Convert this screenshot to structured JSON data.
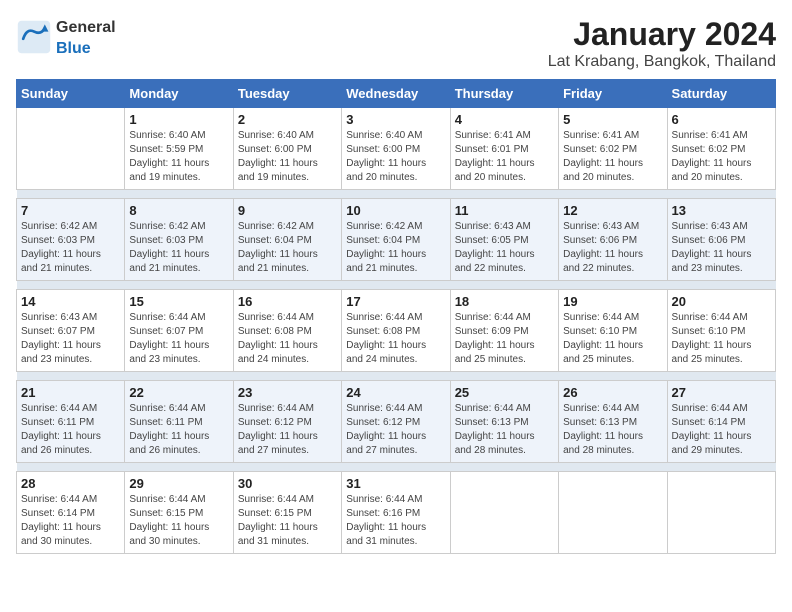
{
  "header": {
    "logo_general": "General",
    "logo_blue": "Blue",
    "title": "January 2024",
    "subtitle": "Lat Krabang, Bangkok, Thailand"
  },
  "days_of_week": [
    "Sunday",
    "Monday",
    "Tuesday",
    "Wednesday",
    "Thursday",
    "Friday",
    "Saturday"
  ],
  "weeks": [
    [
      {
        "day": "",
        "detail": ""
      },
      {
        "day": "1",
        "detail": "Sunrise: 6:40 AM\nSunset: 5:59 PM\nDaylight: 11 hours\nand 19 minutes."
      },
      {
        "day": "2",
        "detail": "Sunrise: 6:40 AM\nSunset: 6:00 PM\nDaylight: 11 hours\nand 19 minutes."
      },
      {
        "day": "3",
        "detail": "Sunrise: 6:40 AM\nSunset: 6:00 PM\nDaylight: 11 hours\nand 20 minutes."
      },
      {
        "day": "4",
        "detail": "Sunrise: 6:41 AM\nSunset: 6:01 PM\nDaylight: 11 hours\nand 20 minutes."
      },
      {
        "day": "5",
        "detail": "Sunrise: 6:41 AM\nSunset: 6:02 PM\nDaylight: 11 hours\nand 20 minutes."
      },
      {
        "day": "6",
        "detail": "Sunrise: 6:41 AM\nSunset: 6:02 PM\nDaylight: 11 hours\nand 20 minutes."
      }
    ],
    [
      {
        "day": "7",
        "detail": "Sunrise: 6:42 AM\nSunset: 6:03 PM\nDaylight: 11 hours\nand 21 minutes."
      },
      {
        "day": "8",
        "detail": "Sunrise: 6:42 AM\nSunset: 6:03 PM\nDaylight: 11 hours\nand 21 minutes."
      },
      {
        "day": "9",
        "detail": "Sunrise: 6:42 AM\nSunset: 6:04 PM\nDaylight: 11 hours\nand 21 minutes."
      },
      {
        "day": "10",
        "detail": "Sunrise: 6:42 AM\nSunset: 6:04 PM\nDaylight: 11 hours\nand 21 minutes."
      },
      {
        "day": "11",
        "detail": "Sunrise: 6:43 AM\nSunset: 6:05 PM\nDaylight: 11 hours\nand 22 minutes."
      },
      {
        "day": "12",
        "detail": "Sunrise: 6:43 AM\nSunset: 6:06 PM\nDaylight: 11 hours\nand 22 minutes."
      },
      {
        "day": "13",
        "detail": "Sunrise: 6:43 AM\nSunset: 6:06 PM\nDaylight: 11 hours\nand 23 minutes."
      }
    ],
    [
      {
        "day": "14",
        "detail": "Sunrise: 6:43 AM\nSunset: 6:07 PM\nDaylight: 11 hours\nand 23 minutes."
      },
      {
        "day": "15",
        "detail": "Sunrise: 6:44 AM\nSunset: 6:07 PM\nDaylight: 11 hours\nand 23 minutes."
      },
      {
        "day": "16",
        "detail": "Sunrise: 6:44 AM\nSunset: 6:08 PM\nDaylight: 11 hours\nand 24 minutes."
      },
      {
        "day": "17",
        "detail": "Sunrise: 6:44 AM\nSunset: 6:08 PM\nDaylight: 11 hours\nand 24 minutes."
      },
      {
        "day": "18",
        "detail": "Sunrise: 6:44 AM\nSunset: 6:09 PM\nDaylight: 11 hours\nand 25 minutes."
      },
      {
        "day": "19",
        "detail": "Sunrise: 6:44 AM\nSunset: 6:10 PM\nDaylight: 11 hours\nand 25 minutes."
      },
      {
        "day": "20",
        "detail": "Sunrise: 6:44 AM\nSunset: 6:10 PM\nDaylight: 11 hours\nand 25 minutes."
      }
    ],
    [
      {
        "day": "21",
        "detail": "Sunrise: 6:44 AM\nSunset: 6:11 PM\nDaylight: 11 hours\nand 26 minutes."
      },
      {
        "day": "22",
        "detail": "Sunrise: 6:44 AM\nSunset: 6:11 PM\nDaylight: 11 hours\nand 26 minutes."
      },
      {
        "day": "23",
        "detail": "Sunrise: 6:44 AM\nSunset: 6:12 PM\nDaylight: 11 hours\nand 27 minutes."
      },
      {
        "day": "24",
        "detail": "Sunrise: 6:44 AM\nSunset: 6:12 PM\nDaylight: 11 hours\nand 27 minutes."
      },
      {
        "day": "25",
        "detail": "Sunrise: 6:44 AM\nSunset: 6:13 PM\nDaylight: 11 hours\nand 28 minutes."
      },
      {
        "day": "26",
        "detail": "Sunrise: 6:44 AM\nSunset: 6:13 PM\nDaylight: 11 hours\nand 28 minutes."
      },
      {
        "day": "27",
        "detail": "Sunrise: 6:44 AM\nSunset: 6:14 PM\nDaylight: 11 hours\nand 29 minutes."
      }
    ],
    [
      {
        "day": "28",
        "detail": "Sunrise: 6:44 AM\nSunset: 6:14 PM\nDaylight: 11 hours\nand 30 minutes."
      },
      {
        "day": "29",
        "detail": "Sunrise: 6:44 AM\nSunset: 6:15 PM\nDaylight: 11 hours\nand 30 minutes."
      },
      {
        "day": "30",
        "detail": "Sunrise: 6:44 AM\nSunset: 6:15 PM\nDaylight: 11 hours\nand 31 minutes."
      },
      {
        "day": "31",
        "detail": "Sunrise: 6:44 AM\nSunset: 6:16 PM\nDaylight: 11 hours\nand 31 minutes."
      },
      {
        "day": "",
        "detail": ""
      },
      {
        "day": "",
        "detail": ""
      },
      {
        "day": "",
        "detail": ""
      }
    ]
  ]
}
